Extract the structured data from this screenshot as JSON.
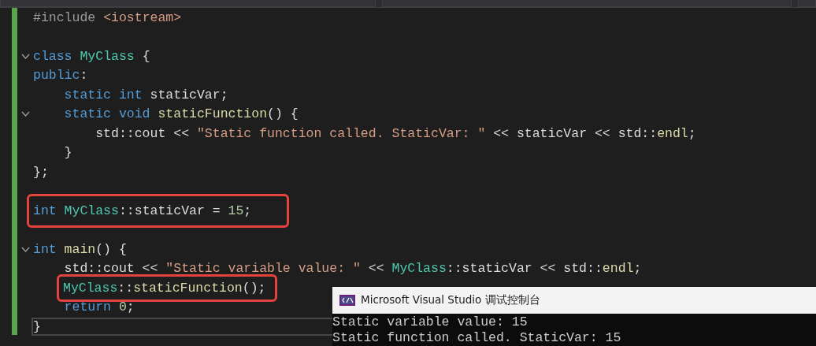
{
  "toolbar": {
    "dropdowns": [
      {
        "kind": "dropdown"
      },
      {
        "kind": "dropdown"
      },
      {
        "kind": "dropdown"
      }
    ]
  },
  "lines": [
    {
      "kind": "code",
      "tokens": [
        {
          "kind": "preproc",
          "text": "#include "
        },
        {
          "kind": "string",
          "text": "<iostream>"
        }
      ]
    },
    {
      "kind": "blank"
    },
    {
      "kind": "code",
      "foldable": true,
      "tokens": [
        {
          "kind": "keyword",
          "text": "class "
        },
        {
          "kind": "type",
          "text": "MyClass"
        },
        {
          "kind": "plain",
          "text": " {"
        }
      ]
    },
    {
      "kind": "code",
      "tokens": [
        {
          "kind": "keyword",
          "text": "public"
        },
        {
          "kind": "plain",
          "text": ":"
        }
      ]
    },
    {
      "kind": "code",
      "tokens": [
        {
          "kind": "keyword",
          "text": "    static int "
        },
        {
          "kind": "plain",
          "text": "staticVar;"
        }
      ]
    },
    {
      "kind": "code",
      "foldable": true,
      "tokens": [
        {
          "kind": "keyword",
          "text": "    static void "
        },
        {
          "kind": "function",
          "text": "staticFunction"
        },
        {
          "kind": "plain",
          "text": "() {"
        }
      ]
    },
    {
      "kind": "code",
      "tokens": [
        {
          "kind": "plain",
          "text": "        std::cout << "
        },
        {
          "kind": "string",
          "text": "\"Static function called. StaticVar: \""
        },
        {
          "kind": "plain",
          "text": " << staticVar << std::"
        },
        {
          "kind": "function",
          "text": "endl"
        },
        {
          "kind": "plain",
          "text": ";"
        }
      ]
    },
    {
      "kind": "code",
      "tokens": [
        {
          "kind": "plain",
          "text": "    }"
        }
      ]
    },
    {
      "kind": "code",
      "tokens": [
        {
          "kind": "plain",
          "text": "};"
        }
      ]
    },
    {
      "kind": "blank"
    },
    {
      "kind": "code",
      "highlighted": true,
      "tokens": [
        {
          "kind": "keyword",
          "text": "int "
        },
        {
          "kind": "type",
          "text": "MyClass"
        },
        {
          "kind": "plain",
          "text": "::staticVar = "
        },
        {
          "kind": "number",
          "text": "15"
        },
        {
          "kind": "plain",
          "text": ";"
        }
      ]
    },
    {
      "kind": "blank"
    },
    {
      "kind": "code",
      "foldable": true,
      "tokens": [
        {
          "kind": "keyword",
          "text": "int "
        },
        {
          "kind": "function",
          "text": "main"
        },
        {
          "kind": "plain",
          "text": "() {"
        }
      ]
    },
    {
      "kind": "code",
      "tokens": [
        {
          "kind": "plain",
          "text": "    std::cout << "
        },
        {
          "kind": "string",
          "text": "\"Static variable value: \""
        },
        {
          "kind": "plain",
          "text": " << "
        },
        {
          "kind": "type",
          "text": "MyClass"
        },
        {
          "kind": "plain",
          "text": "::staticVar << std::"
        },
        {
          "kind": "function",
          "text": "endl"
        },
        {
          "kind": "plain",
          "text": ";"
        }
      ]
    },
    {
      "kind": "code",
      "highlighted": true,
      "tokens": [
        {
          "kind": "type",
          "text": "MyClass"
        },
        {
          "kind": "plain",
          "text": "::"
        },
        {
          "kind": "function",
          "text": "staticFunction"
        },
        {
          "kind": "plain",
          "text": "();"
        }
      ]
    },
    {
      "kind": "code",
      "tokens": [
        {
          "kind": "keyword",
          "text": "    return "
        },
        {
          "kind": "number",
          "text": "0"
        },
        {
          "kind": "plain",
          "text": ";"
        }
      ]
    },
    {
      "kind": "code",
      "current": true,
      "tokens": [
        {
          "kind": "plain",
          "text": "}"
        }
      ]
    }
  ],
  "console": {
    "title": "Microsoft Visual Studio 调试控制台",
    "output": [
      "Static variable value: 15",
      "Static function called. StaticVar: 15"
    ]
  }
}
